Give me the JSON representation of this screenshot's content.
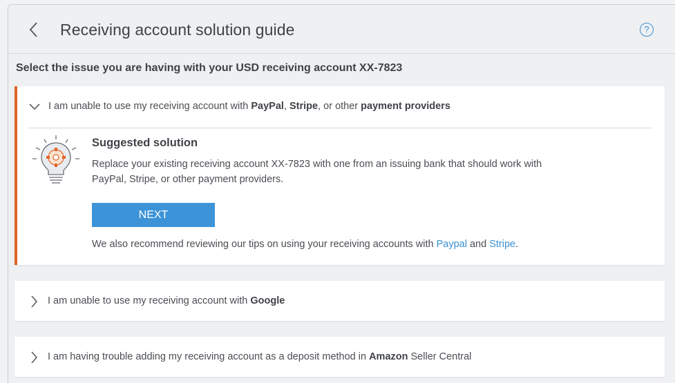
{
  "header": {
    "title": "Receiving account solution guide",
    "help_icon": "?"
  },
  "subheading": "Select the issue you are having with your USD receiving account XX-7823",
  "issues": [
    {
      "pre": "I am unable to use my receiving account with ",
      "b1": "PayPal",
      "mid1": ", ",
      "b2": "Stripe",
      "mid2": ", or other ",
      "b3": "payment providers",
      "expanded": true
    },
    {
      "pre": "I am unable to use my receiving account with ",
      "b1": "Google",
      "expanded": false
    },
    {
      "pre": "I am having trouble adding my receiving account as a deposit method in ",
      "b1": "Amazon",
      "post": " Seller Central",
      "expanded": false
    }
  ],
  "solution": {
    "title": "Suggested solution",
    "text": "Replace your existing receiving account XX-7823 with one from an issuing bank that should work with PayPal, Stripe, or other payment providers.",
    "next_label": "NEXT",
    "tips_pre": "We also recommend reviewing our tips on using your receiving accounts with ",
    "tips_link1": "Paypal",
    "tips_and": " and ",
    "tips_link2": "Stripe",
    "tips_end": "."
  },
  "colors": {
    "accent": "#e1642b",
    "primary": "#3d93d7",
    "link": "#3a8fd0"
  },
  "icons": {
    "back": "chevron-left-icon",
    "help": "help-circle-icon",
    "expanded": "chevron-down-icon",
    "collapsed": "chevron-right-icon",
    "solution": "lightbulb-gear-icon"
  }
}
